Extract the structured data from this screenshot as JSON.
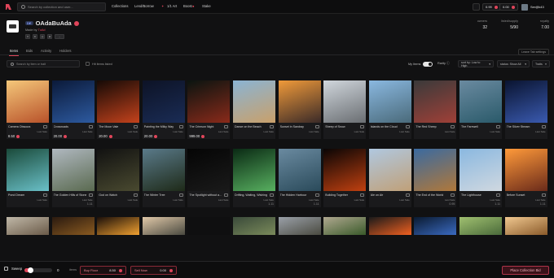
{
  "topbar": {
    "search_placeholder": "Search by collection and user...",
    "nav": [
      "Collections",
      "Lend/Borrow",
      "1/1 Art",
      "Boost",
      "Stake"
    ],
    "balance_a": "0.99",
    "balance_b": "0.00",
    "username": "Ser@k43"
  },
  "collection": {
    "name": "OAdaBuAda",
    "label": "DE",
    "made_by_prefix": "Made by",
    "made_by": "TuAd",
    "socials": [
      "✕",
      "D",
      "◎",
      "⊕",
      "..."
    ],
    "stats": [
      {
        "label": "owners",
        "value": "32"
      },
      {
        "label": "listed/supply",
        "value": "5/90"
      },
      {
        "label": "royalty",
        "value": "7.00"
      }
    ]
  },
  "tabs": [
    "Items",
    "Bids",
    "Activity",
    "Holders"
  ],
  "active_tab": "Items",
  "change_link": "Leave Tab settings",
  "filters": {
    "search_placeholder": "Search by item or trait",
    "checkbox_label": "Hit items listed",
    "my_items_label": "My Items",
    "rarity_label": "Rarity",
    "sort_label": "sort by: Low to High",
    "status_label": "status: Show All",
    "traits_label": "Traits"
  },
  "cards": [
    {
      "name": "Camera Obscura",
      "price": "8.50",
      "sub": "Last Sale",
      "rank": ""
    },
    {
      "name": "Crossroads",
      "price": "20.00",
      "sub": "Last Sale",
      "rank": ""
    },
    {
      "name": "The Moon Vale",
      "price": "20.00",
      "sub": "Last Sale",
      "rank": ""
    },
    {
      "name": "Painting the Milky Way",
      "price": "20.00",
      "sub": "Last Sale",
      "rank": ""
    },
    {
      "name": "The Crimson Night",
      "price": "999.00",
      "sub": "Last Sale",
      "rank": ""
    },
    {
      "name": "Dance on the Beach",
      "price": "",
      "sub": "Last Sale",
      "rank": ""
    },
    {
      "name": "Sunset in Sandray",
      "price": "",
      "sub": "Last Sale",
      "rank": ""
    },
    {
      "name": "Sheep of Snow",
      "price": "",
      "sub": "Last Sale",
      "rank": ""
    },
    {
      "name": "Islands on the Cloud",
      "price": "",
      "sub": "Last Sale",
      "rank": ""
    },
    {
      "name": "The Red Sheep",
      "price": "",
      "sub": "Last Sale",
      "rank": ""
    },
    {
      "name": "The Farewell",
      "price": "",
      "sub": "Last Sale",
      "rank": ""
    },
    {
      "name": "The Silver Stream",
      "price": "",
      "sub": "Last Sale",
      "rank": ""
    },
    {
      "name": "Pond Dream",
      "price": "",
      "sub": "Last Sale",
      "rank": ""
    },
    {
      "name": "The Golden Hills of Stone",
      "price": "",
      "sub": "Last Sale",
      "rank": "1.11"
    },
    {
      "name": "God on Watch",
      "price": "",
      "sub": "Last Sale",
      "rank": ""
    },
    {
      "name": "The Winter Tree",
      "price": "",
      "sub": "Last Sale",
      "rank": ""
    },
    {
      "name": "The Spotlight without a...",
      "price": "",
      "sub": "Last Sale",
      "rank": ""
    },
    {
      "name": "Drifting, Waiting, Wishing",
      "price": "",
      "sub": "Last Sale",
      "rank": "1.11"
    },
    {
      "name": "The Hidden Harbour",
      "price": "",
      "sub": "Last Sale",
      "rank": "1.11"
    },
    {
      "name": "Building Together",
      "price": "",
      "sub": "Last Sale",
      "rank": ""
    },
    {
      "name": "Ale on Air",
      "price": "",
      "sub": "Last Sale",
      "rank": ""
    },
    {
      "name": "The End of the World",
      "price": "",
      "sub": "Last Sale",
      "rank": "0.95"
    },
    {
      "name": "The Lighthouse",
      "price": "",
      "sub": "Last Sale",
      "rank": "1.11"
    },
    {
      "name": "Before Sunset",
      "price": "",
      "sub": "Last Sale",
      "rank": "1.11"
    },
    {
      "name": "",
      "price": "",
      "sub": "",
      "rank": ""
    },
    {
      "name": "",
      "price": "",
      "sub": "",
      "rank": ""
    },
    {
      "name": "",
      "price": "",
      "sub": "",
      "rank": ""
    },
    {
      "name": "",
      "price": "",
      "sub": "",
      "rank": ""
    },
    {
      "name": "",
      "price": "",
      "sub": "",
      "rank": ""
    },
    {
      "name": "",
      "price": "",
      "sub": "",
      "rank": ""
    },
    {
      "name": "",
      "price": "",
      "sub": "",
      "rank": ""
    },
    {
      "name": "",
      "price": "",
      "sub": "",
      "rank": ""
    },
    {
      "name": "",
      "price": "",
      "sub": "",
      "rank": ""
    },
    {
      "name": "",
      "price": "",
      "sub": "",
      "rank": ""
    },
    {
      "name": "",
      "price": "",
      "sub": "",
      "rank": ""
    },
    {
      "name": "",
      "price": "",
      "sub": "",
      "rank": ""
    }
  ],
  "bottom": {
    "sweep_label": "Sweep",
    "sweep_count": "0",
    "items_label": "items",
    "buy_label": "Buy Floor",
    "buy_value": "8.50",
    "sell_label": "Sell Now",
    "sell_value": "0.00",
    "bid_label": "Place Collection Bid",
    "slider_level": 0.2
  }
}
